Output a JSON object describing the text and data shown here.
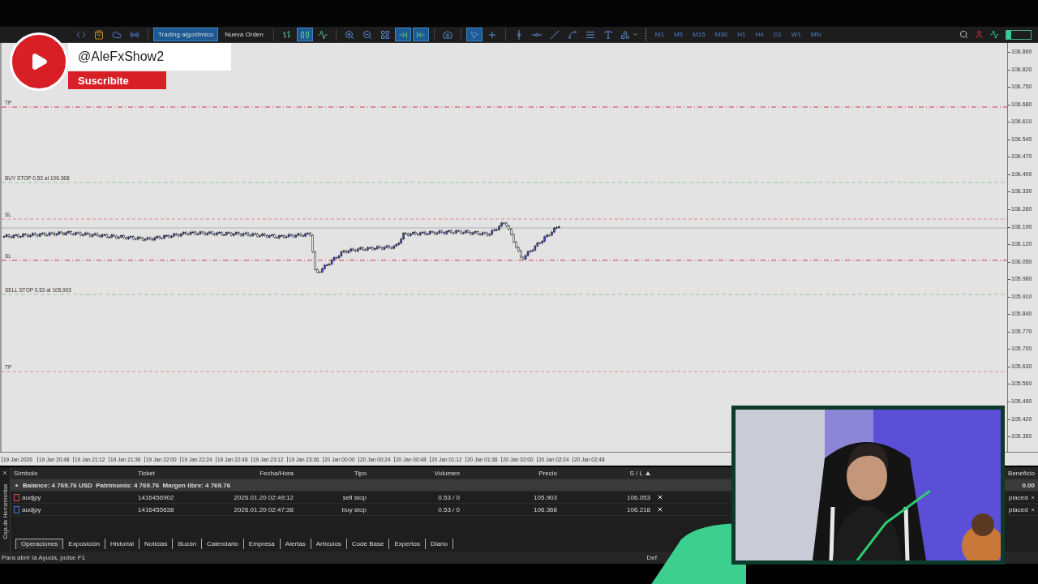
{
  "toolbar": {
    "apps": [
      {
        "kind": "code"
      },
      {
        "kind": "market"
      },
      {
        "kind": "cloud"
      },
      {
        "kind": "signals"
      }
    ],
    "buttons": [
      {
        "label": "Trading algorítmico",
        "selected": true
      },
      {
        "label": "Nueva Orden",
        "selected": false
      }
    ],
    "chart_tools": [
      {
        "kind": "bars",
        "selected": false
      },
      {
        "kind": "candles",
        "selected": true
      },
      {
        "kind": "line",
        "selected": false
      },
      {
        "kind": "sep"
      },
      {
        "kind": "zoom-in",
        "selected": false
      },
      {
        "kind": "zoom-out",
        "selected": false
      },
      {
        "kind": "grid",
        "selected": false
      },
      {
        "kind": "autoscroll",
        "selected": true
      },
      {
        "kind": "shift",
        "selected": true
      },
      {
        "kind": "sep"
      },
      {
        "kind": "screenshot",
        "selected": false
      },
      {
        "kind": "sep"
      },
      {
        "kind": "cursor",
        "selected": true
      },
      {
        "kind": "crosshair",
        "selected": false
      },
      {
        "kind": "sep"
      },
      {
        "kind": "vline",
        "selected": false
      },
      {
        "kind": "hline",
        "selected": false
      },
      {
        "kind": "trendline",
        "selected": false
      },
      {
        "kind": "channel",
        "selected": false
      },
      {
        "kind": "fibo",
        "selected": false
      },
      {
        "kind": "text",
        "selected": false
      },
      {
        "kind": "shapes",
        "selected": false
      }
    ],
    "timeframes": [
      "M1",
      "M5",
      "M15",
      "M30",
      "H1",
      "H4",
      "D1",
      "W1",
      "MN"
    ]
  },
  "overlay": {
    "handle": "@AleFxShow2",
    "button": "Suscribite"
  },
  "chart": {
    "lines": [
      {
        "kind": "tp",
        "label": "TP"
      },
      {
        "kind": "buy-stop",
        "label": "BUY STOP 0.53 at 106.368"
      },
      {
        "kind": "sl-light",
        "label": "SL"
      },
      {
        "kind": "sl",
        "label": "SL"
      },
      {
        "kind": "sell-stop",
        "label": "SELL STOP 0.53 at 105.903"
      },
      {
        "kind": "tp-light",
        "label": "TP"
      }
    ],
    "price_ticks": [
      "106.890",
      "106.820",
      "106.750",
      "106.680",
      "106.610",
      "106.540",
      "106.470",
      "106.400",
      "106.330",
      "106.260",
      "106.190",
      "106.120",
      "106.050",
      "105.980",
      "105.910",
      "105.840",
      "105.770",
      "105.700",
      "105.630",
      "105.560",
      "105.490",
      "105.420",
      "105.350"
    ],
    "time_labels": [
      "19 Jan 2026",
      "19 Jan 20:48",
      "19 Jan 21:12",
      "19 Jan 21:36",
      "19 Jan 22:00",
      "19 Jan 22:24",
      "19 Jan 22:48",
      "19 Jan 23:12",
      "19 Jan 23:36",
      "20 Jan 00:00",
      "20 Jan 00:24",
      "20 Jan 00:48",
      "20 Jan 01:12",
      "20 Jan 01:36",
      "20 Jan 02:00",
      "20 Jan 02:24",
      "20 Jan 02:48"
    ]
  },
  "toolbox": {
    "title": "Caja de Herramientas",
    "columns": [
      "Símbolo",
      "Ticket",
      "Fecha/Hora",
      "Tipo",
      "Volumen",
      "Precio",
      "S / L"
    ],
    "last_column": "Beneficio",
    "summary": "Balance: 4 769.76 USD  Patrimonio: 4 769.76  Margen libre: 4 769.76",
    "summary_profit": "0.00",
    "orders": [
      {
        "symbol": "audjpy",
        "ticket": "1416456902",
        "time": "2026.01.20 02:49:12",
        "type": "sell stop",
        "volume": "0.53 / 0",
        "price": "105.903",
        "sl": "106.053",
        "status": "placed",
        "color": "#d84a4a"
      },
      {
        "symbol": "audjpy",
        "ticket": "1416455638",
        "time": "2026.01.20 02:47:38",
        "type": "buy stop",
        "volume": "0.53 / 0",
        "price": "106.368",
        "sl": "106.218",
        "status": "placed",
        "color": "#4a78d8"
      }
    ],
    "tabs": [
      {
        "label": "Operaciones",
        "selected": true
      },
      {
        "label": "Exposición",
        "selected": false
      },
      {
        "label": "Historial",
        "selected": false
      },
      {
        "label": "Noticias",
        "selected": false
      },
      {
        "label": "Buzón",
        "selected": false
      },
      {
        "label": "Calendario",
        "selected": false
      },
      {
        "label": "Empresa",
        "selected": false
      },
      {
        "label": "Alertas",
        "selected": false
      },
      {
        "label": "Artículos",
        "selected": false
      },
      {
        "label": "Code Base",
        "selected": false
      },
      {
        "label": "Expertos",
        "selected": false
      },
      {
        "label": "Diario",
        "selected": false
      }
    ]
  },
  "status_bar": {
    "help": "Para abrir la Ayuda, pulse F1",
    "right": "Def"
  }
}
